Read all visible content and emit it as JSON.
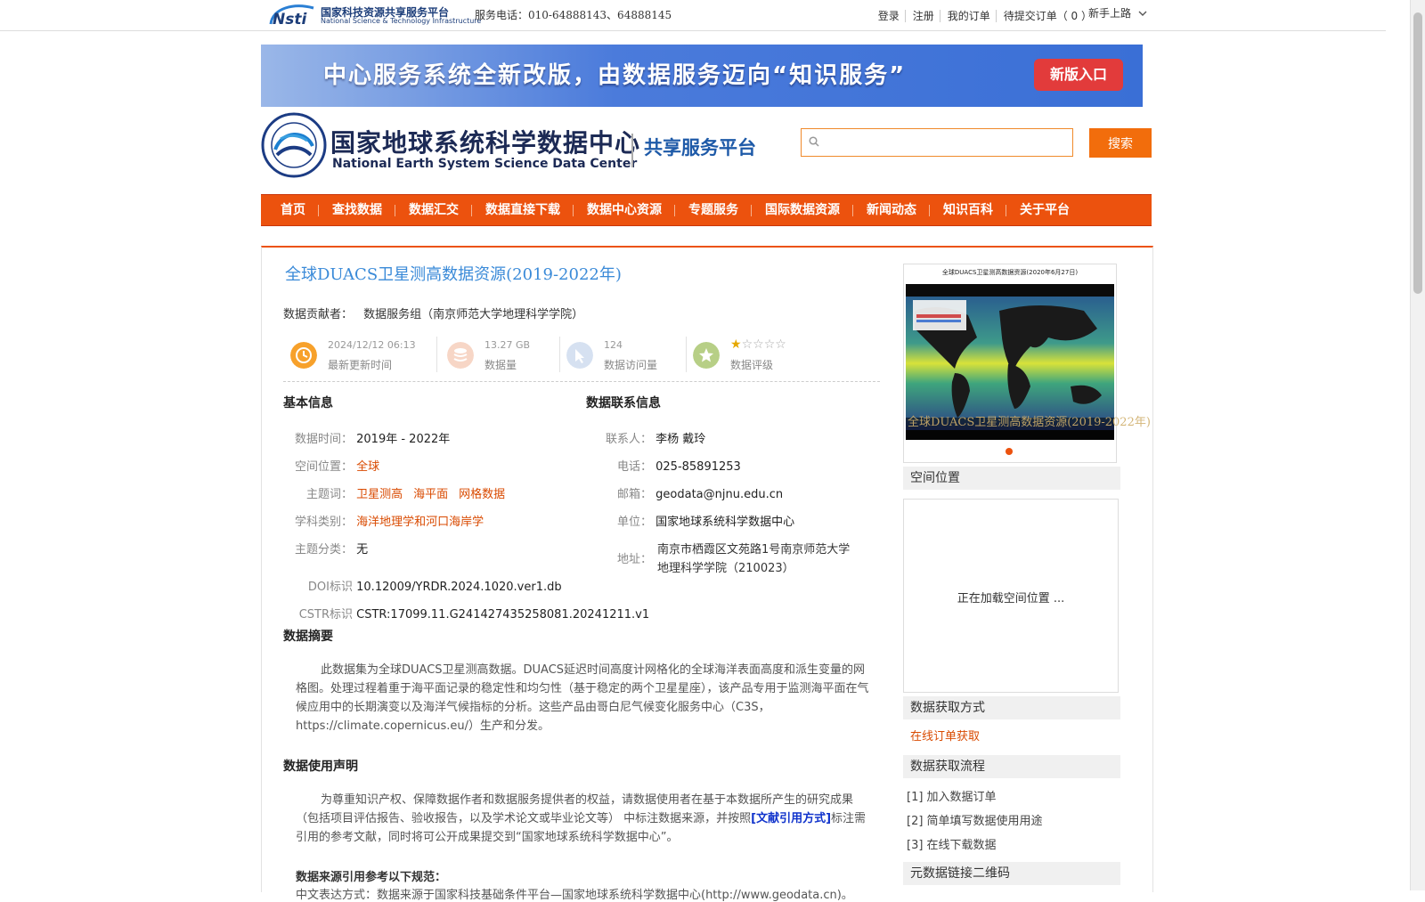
{
  "topbar": {
    "brand_cn": "国家科技资源共享服务平台",
    "brand_en": "National Science & Technology Infrastructure",
    "phone_label": "服务电话：",
    "phone_value": "010-64888143、64888145",
    "links": [
      "登录",
      "注册",
      "我的订单",
      "待提交订单（ 0 ）"
    ],
    "guide": "新手上路"
  },
  "banner": {
    "text": "中心服务系统全新改版，由数据服务迈向“知识服务”",
    "button": "新版入口"
  },
  "header": {
    "org_cn": "国家地球系统科学数据中心",
    "org_en": "National Earth System Science Data Center",
    "platform": "共享服务平台",
    "search_placeholder": "",
    "search_button": "搜索"
  },
  "nav": [
    "首页",
    "查找数据",
    "数据汇交",
    "数据直接下载",
    "数据中心资源",
    "专题服务",
    "国际数据资源",
    "新闻动态",
    "知识百科",
    "关于平台"
  ],
  "dataset": {
    "title": "全球DUACS卫星测高数据资源(2019-2022年)",
    "contributor_label": "数据贡献者：",
    "contributor": "数据服务组（南京师范大学地理科学学院）",
    "stats": [
      {
        "value": "2024/12/12 06:13",
        "label": "最新更新时间"
      },
      {
        "value": "13.27 GB",
        "label": "数据量"
      },
      {
        "value": "124",
        "label": "数据访问量"
      },
      {
        "value": "",
        "label": "数据评级"
      }
    ],
    "rating": 1,
    "rating_max": 5
  },
  "basic": {
    "title": "基本信息",
    "time_k": "数据时间：",
    "time_v": "2019年 - 2022年",
    "space_k": "空间位置：",
    "space_v": "全球",
    "keywords_k": "主题词：",
    "keywords": [
      "卫星测高",
      "海平面",
      "网格数据"
    ],
    "discipline_k": "学科类别：",
    "discipline_v": "海洋地理学和河口海岸学",
    "category_k": "主题分类：",
    "category_v": "无",
    "doi_k": "DOI标识",
    "doi_v": "10.12009/YRDR.2024.1020.ver1.db",
    "cstr_k": "CSTR标识",
    "cstr_v": "CSTR:17099.11.G241427435258081.20241211.v1"
  },
  "contact": {
    "title": "数据联系信息",
    "person_k": "联系人：",
    "person_v": "李杨 戴玲",
    "tel_k": "电话：",
    "tel_v": "025-85891253",
    "email_k": "邮箱：",
    "email_v": "geodata@njnu.edu.cn",
    "unit_k": "单位：",
    "unit_v": "国家地球系统科学数据中心",
    "addr_k": "地址：",
    "addr_v1": "南京市栖霞区文苑路1号南京师范大学",
    "addr_v2": "地理科学学院（210023）"
  },
  "abstract": {
    "title": "数据摘要",
    "text": "此数据集为全球DUACS卫星测高数据。DUACS延迟时间高度计网格化的全球海洋表面高度和派生变量的网格图。处理过程着重于海平面记录的稳定性和均匀性（基于稳定的两个卫星星座），该产品专用于监测海平面在气候应用中的长期演变以及海洋气候指标的分析。这些产品由哥白尼气候变化服务中心（C3S，https://climate.copernicus.eu/）生产和分发。"
  },
  "usage": {
    "title": "数据使用声明",
    "text_a": "为尊重知识产权、保障数据作者和数据服务提供者的权益，请数据使用者在基于本数据所产生的研究成果（包括项目评估报告、验收报告，以及学术论文或毕业论文等） 中标注数据来源，并按照",
    "cite_link": "[文献引用方式]",
    "text_b": "标注需引用的参考文献，同时将可公开成果提交到“国家地球系统科学数据中心”。",
    "ref_title": "数据来源引用参考以下规范：",
    "ref_cut": "中文表达方式：数据来源于国家科技基础条件平台—国家地球系统科学数据中心(http://www.geodata.cn)。"
  },
  "sidebar": {
    "thumb_caption": "全球DUACS卫星测高数据资源(2020年6月27日)",
    "thumb_overlay": "全球DUACS卫星测高数据资源(2019-2022年)",
    "location_title": "空间位置",
    "location_loading": "正在加载空间位置 ...",
    "access_title": "数据获取方式",
    "access_link": "在线订单获取",
    "flow_title": "数据获取流程",
    "steps": [
      "[1] 加入数据订单",
      "[2] 简单填写数据使用用途",
      "[3] 在线下载数据"
    ],
    "qr_title": "元数据链接二维码"
  }
}
